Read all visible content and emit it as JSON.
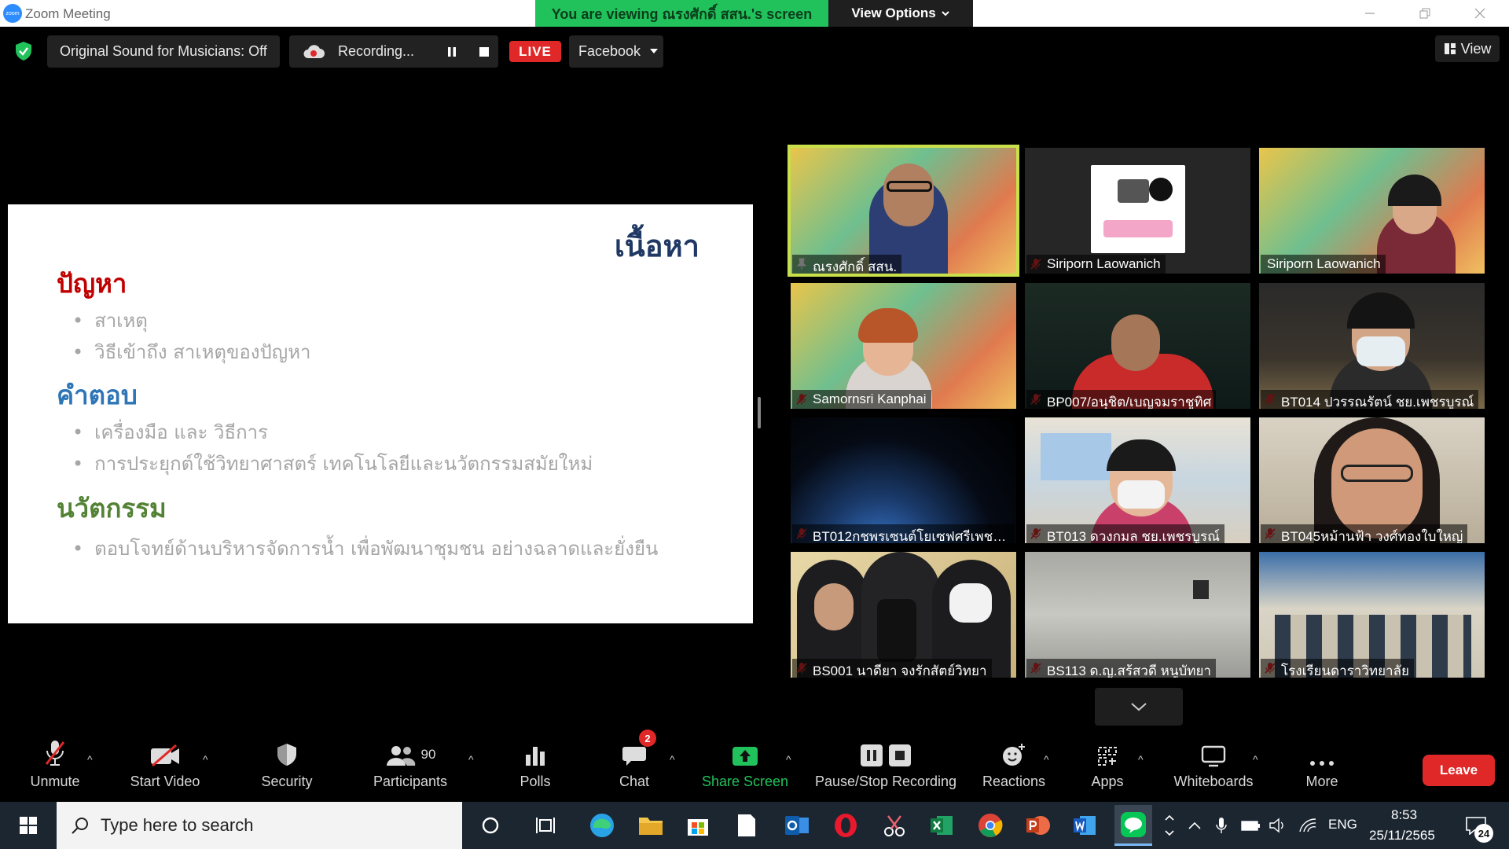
{
  "titlebar": {
    "app_title": "Zoom Meeting",
    "viewing_banner": "You are viewing ณรงศักดิ์ สสน.'s screen",
    "view_options": "View Options"
  },
  "meeting_bar": {
    "original_sound": "Original Sound for Musicians: Off",
    "recording": "Recording...",
    "live": "LIVE",
    "stream_target": "Facebook",
    "view": "View"
  },
  "slide": {
    "title": "เนื้อหา",
    "sections": [
      {
        "heading": "ปัญหา",
        "color": "#c00000",
        "bullets": [
          "สาเหตุ",
          "วิธีเข้าถึง สาเหตุของปัญหา"
        ]
      },
      {
        "heading": "คำตอบ",
        "color": "#2e75b6",
        "bullets": [
          "เครื่องมือ และ วิธีการ",
          "การประยุกต์ใช้วิทยาศาสตร์ เทคโนโลยีและนวัตกรรมสมัยใหม่"
        ]
      },
      {
        "heading": "นวัตกรรม",
        "color": "#548235",
        "bullets": [
          "ตอบโจทย์ด้านบริหารจัดการน้ำ เพื่อพัฒนาชุมชน อย่างฉลาดและยั่งยืน"
        ]
      }
    ]
  },
  "participants": [
    {
      "name": "ณรงศักดิ์ สสน.",
      "active": true,
      "muted": false
    },
    {
      "name": "Siriporn Laowanich",
      "muted": true
    },
    {
      "name": "Siriporn Laowanich",
      "muted": false
    },
    {
      "name": "Samornsri Kanphai",
      "muted": true
    },
    {
      "name": "BP007/อนุชิต/เบญจมราชูทิศ",
      "muted": true
    },
    {
      "name": "BT014 ปวรรณรัตน์ ชย.เพชรบูรณ์",
      "muted": true
    },
    {
      "name": "BT012กชพรเซนต์โยเซฟศรีเพชร...",
      "muted": true
    },
    {
      "name": "BT013 ดวงกมล ชย.เพชรบูรณ์",
      "muted": true
    },
    {
      "name": "BT045หม้านฟ้า วงศ์ทองใบใหญ่",
      "muted": true
    },
    {
      "name": "BS001 นาดียา จงรักสัตย์วิทยา",
      "muted": true
    },
    {
      "name": "BS113 ด.ญ.สร้สวดี หนูบัทยา",
      "muted": true
    },
    {
      "name": "โรงเรียนดาราวิทยาลัย",
      "muted": true
    }
  ],
  "toolbar": {
    "unmute": "Unmute",
    "start_video": "Start Video",
    "security": "Security",
    "participants": "Participants",
    "participants_count": "90",
    "polls": "Polls",
    "chat": "Chat",
    "chat_badge": "2",
    "share_screen": "Share Screen",
    "pause_stop_recording": "Pause/Stop Recording",
    "reactions": "Reactions",
    "apps": "Apps",
    "whiteboards": "Whiteboards",
    "more": "More",
    "leave": "Leave"
  },
  "taskbar": {
    "search_placeholder": "Type here to search",
    "language": "ENG",
    "time": "8:53",
    "date": "25/11/2565",
    "notifications": "24"
  },
  "colors": {
    "zoom_blue": "#2d8cff",
    "banner_green": "#21c25b",
    "leave_red": "#e02828",
    "active_speaker": "#c9e04b",
    "share_green": "#21c25b"
  }
}
